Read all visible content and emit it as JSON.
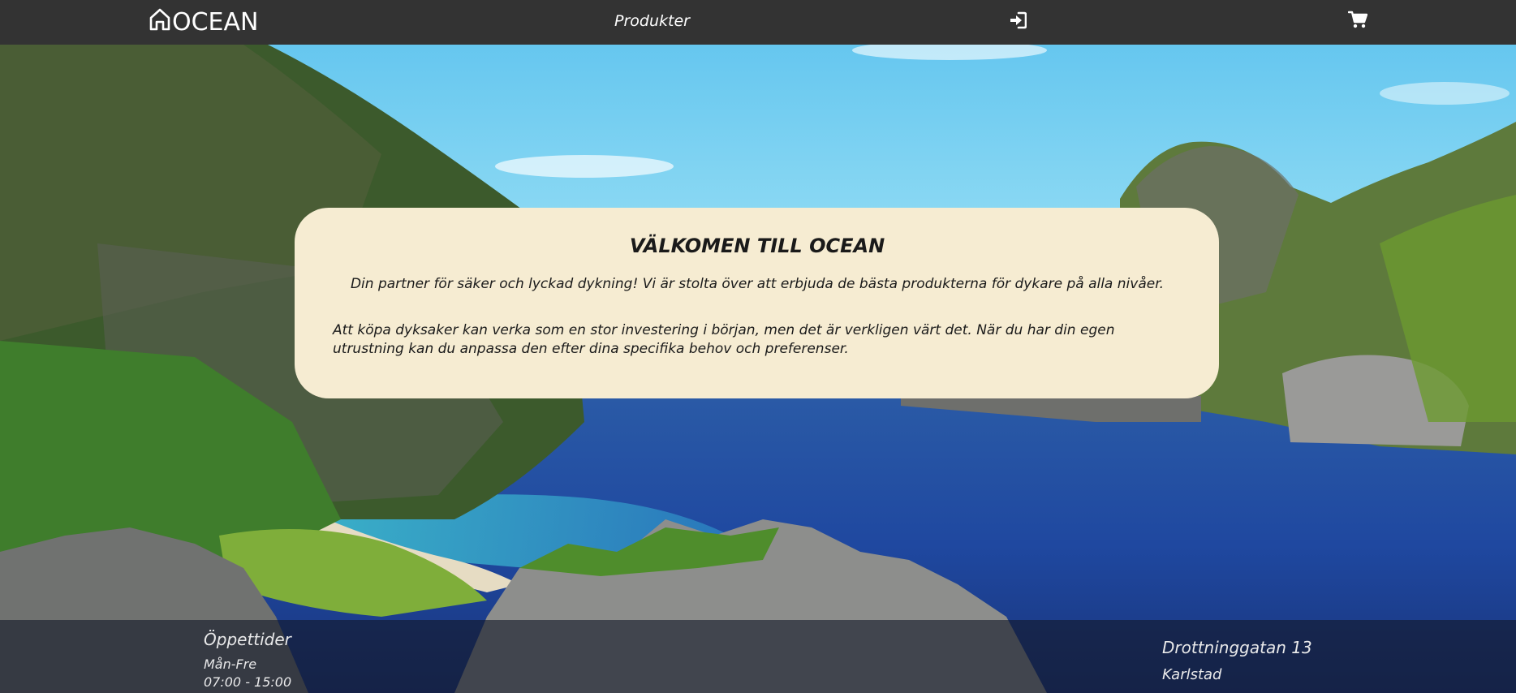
{
  "header": {
    "logo_text": "OCEAN",
    "nav_products": "Produkter",
    "icons": [
      "home-icon",
      "sign-in-icon",
      "cart-icon"
    ]
  },
  "welcome": {
    "title": "VÄLKOMEN TILL OCEAN",
    "lead": "Din partner för säker och lyckad dykning! Vi är stolta över att erbjuda de bästa produkterna för dykare på alla nivåer.",
    "body": "Att köpa dyksaker kan verka som en stor investering i början, men det är verkligen värt det. När du har din egen utrustning kan du anpassa den efter dina specifika behov och preferenser."
  },
  "footer": {
    "hours_title": "Öppettider",
    "hours_days": "Mån-Fre",
    "hours_time": "07:00 - 15:00",
    "address_street": "Drottninggatan 13",
    "address_city": "Karlstad"
  },
  "colors": {
    "navbar": "#333333",
    "card": "#f6ecd2",
    "footer_overlay": "rgba(20,24,40,0.62)"
  }
}
